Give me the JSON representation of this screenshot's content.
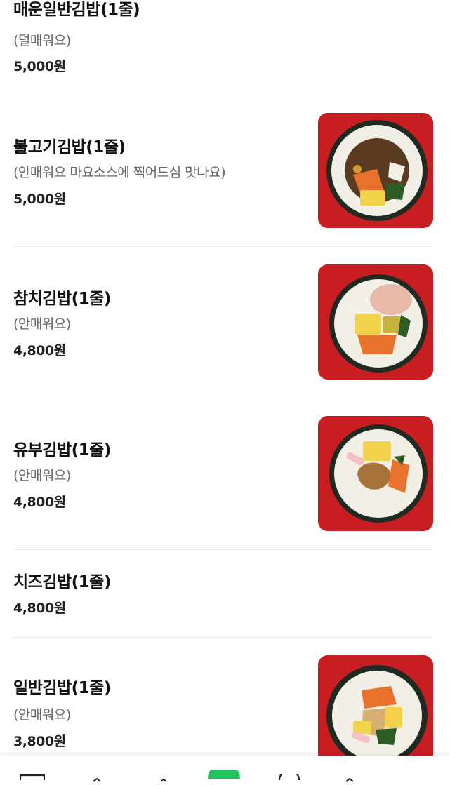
{
  "menu": {
    "items": [
      {
        "name": "매운일반김밥(1줄)",
        "desc": "(덜매워요)",
        "price": "5,000원",
        "image": null
      },
      {
        "name": "불고기김밥(1줄)",
        "desc": "(안매워요 마요소스에 찍어드심 맛나요)",
        "price": "5,000원",
        "image": "bulgogi-kimbap-photo"
      },
      {
        "name": "참치김밥(1줄)",
        "desc": "(안매워요)",
        "price": "4,800원",
        "image": "tuna-kimbap-photo"
      },
      {
        "name": "유부김밥(1줄)",
        "desc": "(안매워요)",
        "price": "4,800원",
        "image": "yubu-kimbap-photo"
      },
      {
        "name": "치즈김밥(1줄)",
        "desc": "",
        "price": "4,800원",
        "image": null
      },
      {
        "name": "일반김밥(1줄)",
        "desc": "(안매워요)",
        "price": "3,800원",
        "image": "basic-kimbap-photo"
      }
    ]
  },
  "bottom_nav": {
    "icons": [
      "home-icon",
      "search-icon",
      "favorite-icon",
      "order-icon",
      "chat-icon",
      "my-icon"
    ],
    "accent": "#2ac1bc"
  },
  "colors": {
    "photo_background": "#c81e22",
    "divider": "#ececec"
  }
}
